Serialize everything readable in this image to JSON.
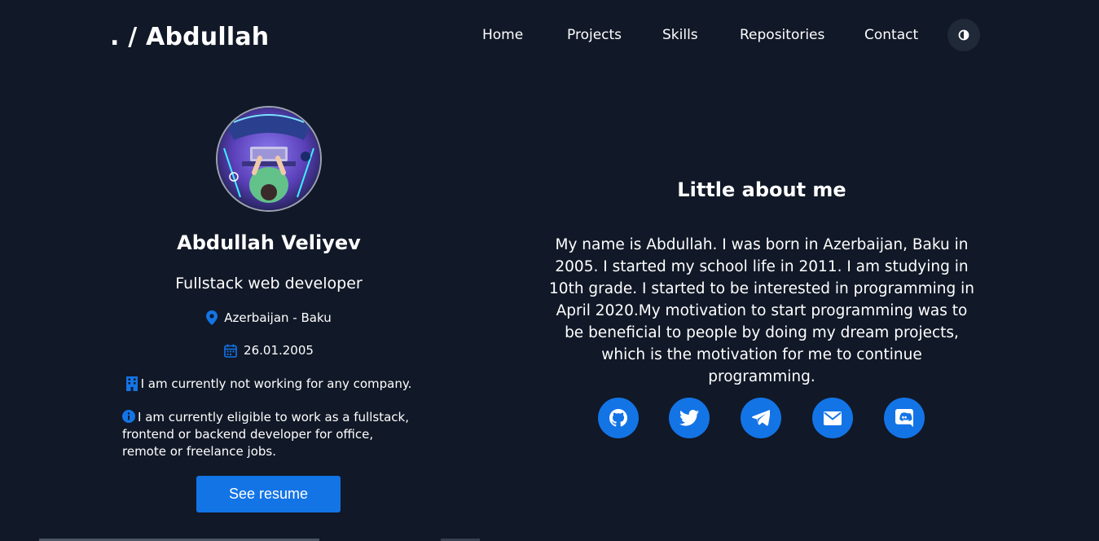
{
  "header": {
    "logo": ". / Abdullah",
    "nav": [
      "Home",
      "Projects",
      "Skills",
      "Repositories",
      "Contact"
    ],
    "theme_toggle_icon": "half-circle-icon"
  },
  "profile": {
    "avatar_icon": "avatar-illustration",
    "name": "Abdullah Veliyev",
    "role": "Fullstack web developer",
    "location": "Azerbaijan - Baku",
    "birthdate": "26.01.2005",
    "company": "I am currently not working for any company.",
    "eligibility": "I am currently eligible to work as a fullstack, frontend or backend developer for office, remote or freelance jobs.",
    "resume_button": "See resume"
  },
  "about": {
    "title": "Little about me",
    "text": "My name is Abdullah. I was born in Azerbaijan, Baku in 2005. I started my school life in 2011. I am studying in 10th grade. I started to be interested in programming in April 2020.My motivation to start programming was to be beneficial to people by doing my dream projects, which is the motivation for me to continue programming.",
    "social_icons": [
      "github-icon",
      "twitter-icon",
      "telegram-icon",
      "email-icon",
      "discord-icon"
    ]
  },
  "colors": {
    "background": "#111827",
    "accent": "#1374e6",
    "toggle_bg": "#1f2937"
  }
}
